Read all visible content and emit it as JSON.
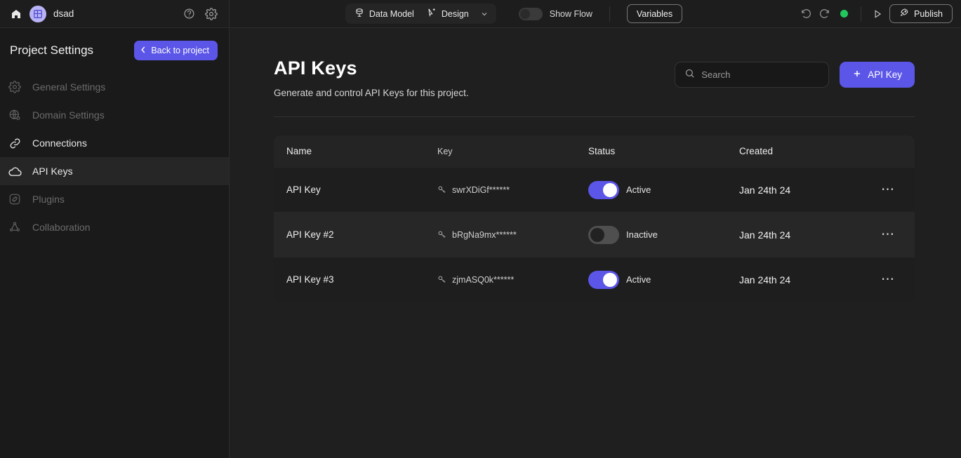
{
  "topbar": {
    "home_icon": "home-icon",
    "project_avatar_icon": "grid-layout-icon",
    "project_name": "dsad",
    "help_icon": "help-circle-icon",
    "settings_icon": "gear-icon",
    "segmented": {
      "data_model_label": "Data Model",
      "data_model_icon": "database-icon",
      "design_label": "Design",
      "design_icon": "cursor-design-icon",
      "caret_icon": "chevron-down-icon"
    },
    "show_flow_label": "Show Flow",
    "show_flow_on": false,
    "variables_label": "Variables",
    "undo_icon": "undo-icon",
    "redo_icon": "redo-icon",
    "status_dot_color": "#22c55e",
    "play_icon": "play-icon",
    "publish_label": "Publish",
    "publish_icon": "rocket-icon"
  },
  "sidebar": {
    "title": "Project Settings",
    "back_label": "Back to project",
    "back_icon": "chevron-left-icon",
    "back_color": "#5b56e8",
    "items": [
      {
        "label": "General Settings",
        "icon": "gear-icon",
        "state": "dim"
      },
      {
        "label": "Domain Settings",
        "icon": "globe-icon",
        "state": "dim"
      },
      {
        "label": "Connections",
        "icon": "link-icon",
        "state": "normal"
      },
      {
        "label": "API Keys",
        "icon": "cloud-icon",
        "state": "active"
      },
      {
        "label": "Plugins",
        "icon": "plugin-icon",
        "state": "dim"
      },
      {
        "label": "Collaboration",
        "icon": "collaboration-icon",
        "state": "dim"
      }
    ]
  },
  "main": {
    "title": "API Keys",
    "subtitle": "Generate and control API Keys for this project.",
    "search": {
      "placeholder": "Search",
      "value": "",
      "icon": "search-icon"
    },
    "add_button": {
      "label": "API Key",
      "icon": "plus-icon",
      "color": "#5b56e8"
    },
    "table": {
      "columns": [
        "Name",
        "Key",
        "Status",
        "Created"
      ],
      "rows": [
        {
          "name": "API Key",
          "key": "swrXDiGf******",
          "key_icon": "key-icon",
          "status": "Active",
          "active": true,
          "created": "Jan 24th 24",
          "menu_icon": "more-horizontal-icon"
        },
        {
          "name": "API Key #2",
          "key": "bRgNa9mx******",
          "key_icon": "key-icon",
          "status": "Inactive",
          "active": false,
          "created": "Jan 24th 24",
          "menu_icon": "more-horizontal-icon"
        },
        {
          "name": "API Key #3",
          "key": "zjmASQ0k******",
          "key_icon": "key-icon",
          "status": "Active",
          "active": true,
          "created": "Jan 24th 24",
          "menu_icon": "more-horizontal-icon"
        }
      ]
    }
  }
}
